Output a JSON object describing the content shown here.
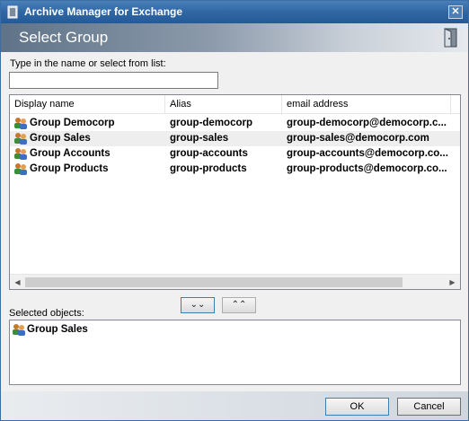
{
  "window": {
    "title": "Archive Manager for Exchange",
    "close_glyph": "✕"
  },
  "header": {
    "heading": "Select Group"
  },
  "search": {
    "label": "Type in the name or select from list:",
    "value": "",
    "placeholder": ""
  },
  "list": {
    "columns": [
      "Display name",
      "Alias",
      "email address",
      ""
    ],
    "rows": [
      {
        "name": "Group Democorp",
        "alias": "group-democorp",
        "email": "group-democorp@democorp.c...",
        "selected": false
      },
      {
        "name": "Group Sales",
        "alias": "group-sales",
        "email": "group-sales@democorp.com",
        "selected": true
      },
      {
        "name": "Group Accounts",
        "alias": "group-accounts",
        "email": "group-accounts@democorp.co...",
        "selected": false
      },
      {
        "name": "Group Products",
        "alias": "group-products",
        "email": "group-products@democorp.co...",
        "selected": false
      }
    ],
    "scroll_left_glyph": "◀",
    "scroll_right_glyph": "▶"
  },
  "transfer": {
    "add_glyph": "⌄⌄",
    "remove_glyph": "⌃⌃"
  },
  "selected": {
    "label": "Selected objects:",
    "items": [
      "Group Sales"
    ]
  },
  "buttons": {
    "ok": "OK",
    "cancel": "Cancel"
  },
  "icons": {
    "group": "group-icon",
    "app": "archive-app-icon",
    "exit": "door-exit-icon"
  }
}
